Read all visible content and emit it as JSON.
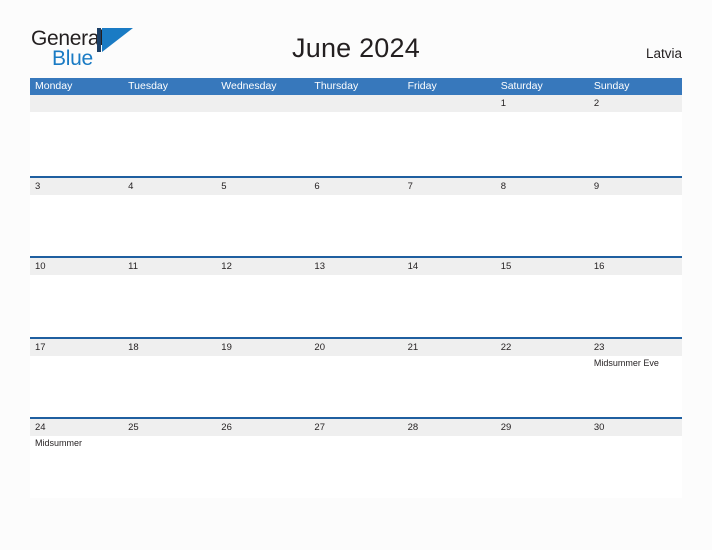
{
  "brand": {
    "name_part1": "General",
    "name_part2": "Blue",
    "mark": "flag-triangle-icon"
  },
  "header": {
    "title": "June 2024",
    "country": "Latvia"
  },
  "colors": {
    "header_blue": "#3778bc",
    "row_divider_blue": "#1f5fa0",
    "band_gray": "#efefef",
    "brand_blue": "#1a7bc4",
    "text": "#231f20",
    "page_bg": "#fcfcfc"
  },
  "weekdays": [
    "Monday",
    "Tuesday",
    "Wednesday",
    "Thursday",
    "Friday",
    "Saturday",
    "Sunday"
  ],
  "weeks": [
    [
      {
        "date": ""
      },
      {
        "date": ""
      },
      {
        "date": ""
      },
      {
        "date": ""
      },
      {
        "date": ""
      },
      {
        "date": "1"
      },
      {
        "date": "2"
      }
    ],
    [
      {
        "date": "3"
      },
      {
        "date": "4"
      },
      {
        "date": "5"
      },
      {
        "date": "6"
      },
      {
        "date": "7"
      },
      {
        "date": "8"
      },
      {
        "date": "9"
      }
    ],
    [
      {
        "date": "10"
      },
      {
        "date": "11"
      },
      {
        "date": "12"
      },
      {
        "date": "13"
      },
      {
        "date": "14"
      },
      {
        "date": "15"
      },
      {
        "date": "16"
      }
    ],
    [
      {
        "date": "17"
      },
      {
        "date": "18"
      },
      {
        "date": "19"
      },
      {
        "date": "20"
      },
      {
        "date": "21"
      },
      {
        "date": "22"
      },
      {
        "date": "23",
        "events": [
          "Midsummer Eve"
        ]
      }
    ],
    [
      {
        "date": "24",
        "events": [
          "Midsummer"
        ]
      },
      {
        "date": "25"
      },
      {
        "date": "26"
      },
      {
        "date": "27"
      },
      {
        "date": "28"
      },
      {
        "date": "29"
      },
      {
        "date": "30"
      }
    ]
  ]
}
